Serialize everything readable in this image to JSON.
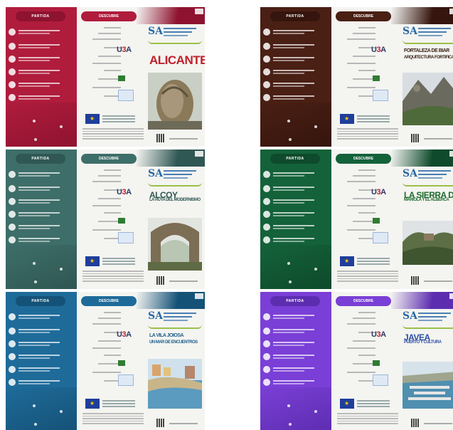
{
  "posters": [
    {
      "header_left": "PARTIDA",
      "header_mid": "DESCUBRE",
      "title_lines": [
        "ALICANTE"
      ],
      "accent": "#b01c3c",
      "accent_dark": "#8e1330",
      "title_color": "#c0202a",
      "photo": "rock"
    },
    {
      "header_left": "PARTIDA",
      "header_mid": "DESCUBRE",
      "title_lines": [
        "FORTALEZA DE BIAR",
        "ARQUITECTURA FORTIFICADA"
      ],
      "accent": "#4a1f14",
      "accent_dark": "#35150d",
      "title_color": "#3a2418",
      "photo": "mountain"
    },
    {
      "header_left": "PARTIDA",
      "header_mid": "DESCUBRE",
      "title_lines": [
        "ALCOY",
        "LA RUTA DEL MODERNISMO"
      ],
      "accent": "#3e6e69",
      "accent_dark": "#2f5753",
      "title_color": "#2f5753",
      "photo": "arch"
    },
    {
      "header_left": "PARTIDA",
      "header_mid": "DESCUBRE",
      "title_lines": [
        "LA SIERRA DE",
        "MARIOLA Y EL ALBERCA"
      ],
      "accent": "#14623a",
      "accent_dark": "#0e4a2b",
      "title_color": "#1d6b2c",
      "photo": "valley"
    },
    {
      "header_left": "PARTIDA",
      "header_mid": "DESCUBRE",
      "title_lines": [
        "LA VILA JOIOSA",
        "UN MAR DE ENCUENTROS"
      ],
      "accent": "#1e6b9a",
      "accent_dark": "#155277",
      "title_color": "#1d5f8a",
      "photo": "coast"
    },
    {
      "header_left": "PARTIDA",
      "header_mid": "DESCUBRE",
      "title_lines": [
        "JAVEA",
        "PUERTO Y CULTURA"
      ],
      "accent": "#7a3fd6",
      "accent_dark": "#5d2db0",
      "title_color": "#2d4fa3",
      "photo": "harbor"
    }
  ],
  "common": {
    "logo_mark": "SA",
    "u3a_u": "U",
    "u3a_3": "3",
    "u3a_a": "A"
  }
}
